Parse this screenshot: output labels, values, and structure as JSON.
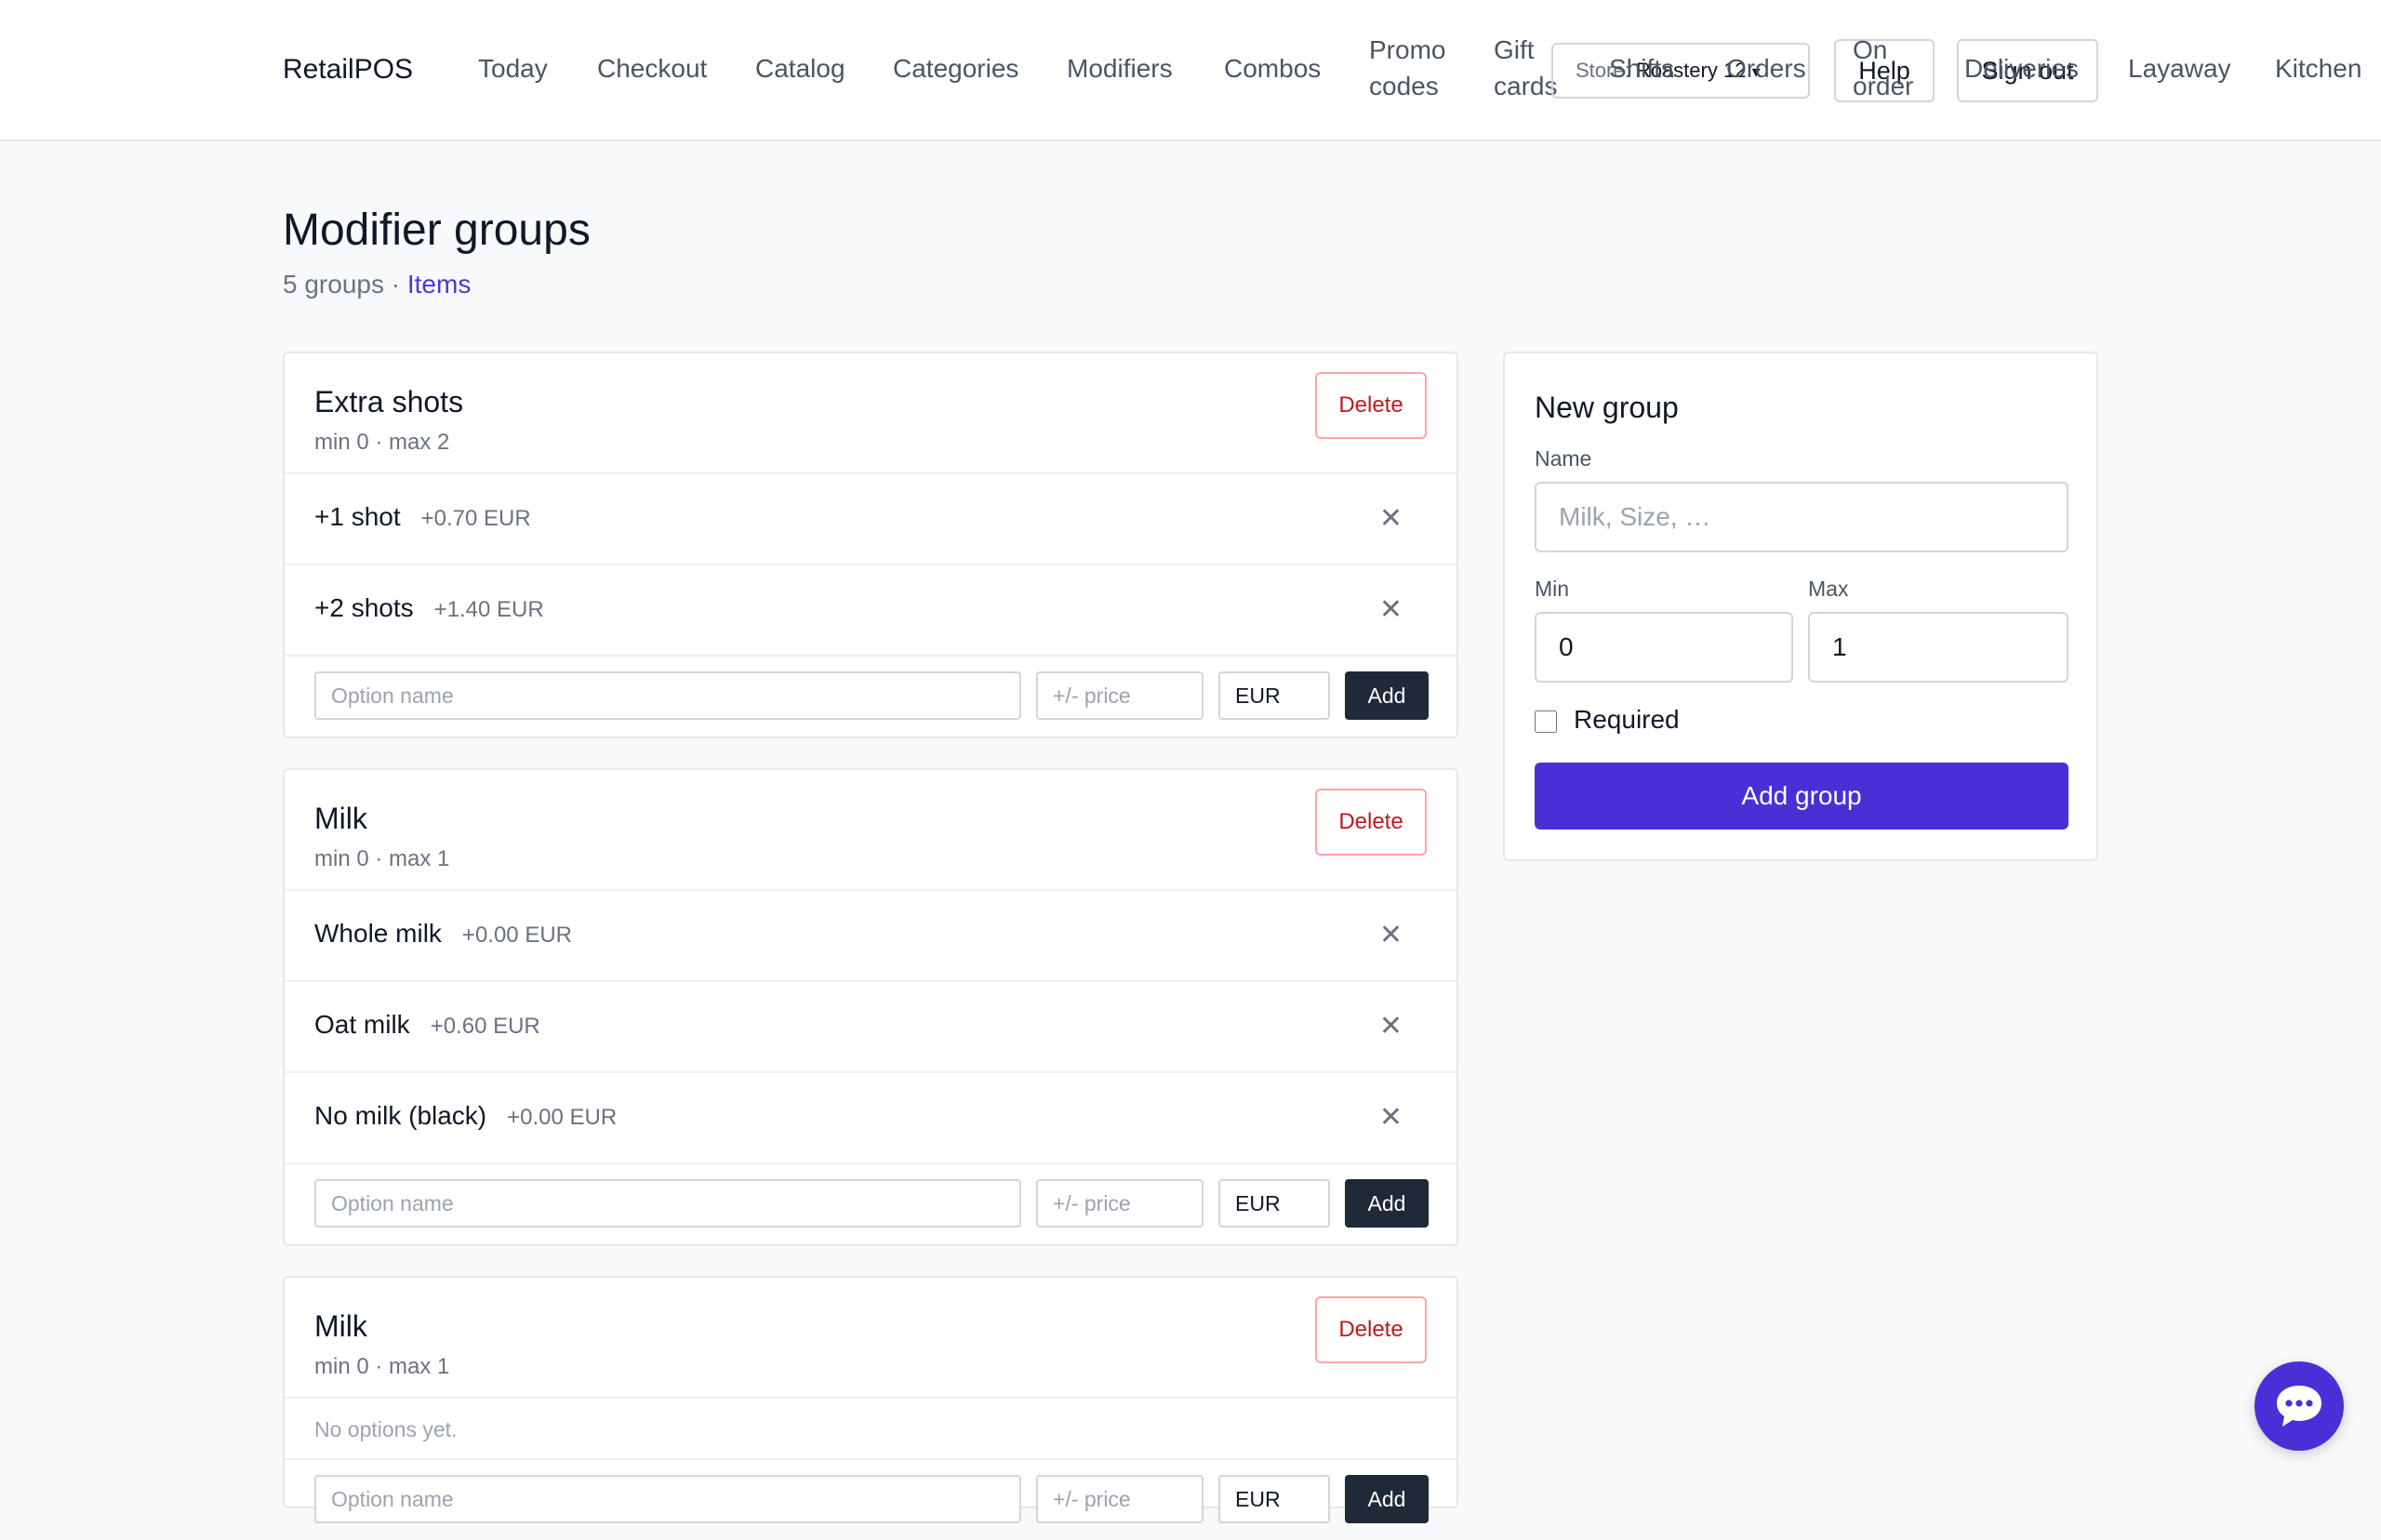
{
  "app": {
    "brand": "RetailPOS"
  },
  "nav": {
    "items": [
      "Today",
      "Checkout",
      "Catalog",
      "Categories",
      "Modifiers",
      "Combos",
      "Promo codes",
      "Gift cards",
      "Shifts",
      "Orders",
      "On order",
      "Deliveries",
      "Layaway",
      "Kitchen"
    ]
  },
  "header": {
    "store_label": "Store:",
    "store_value": "Roastery 12",
    "help": "Help",
    "sign_out": "Sign out"
  },
  "page": {
    "title": "Modifier groups",
    "count": "5 groups",
    "separator": "·",
    "items_link": "Items"
  },
  "groups": [
    {
      "name": "Extra shots",
      "meta": "min 0 · max 2",
      "delete": "Delete",
      "options": [
        {
          "name": "+1 shot",
          "price": "+0.70 EUR"
        },
        {
          "name": "+2 shots",
          "price": "+1.40 EUR"
        }
      ],
      "form": {
        "name_placeholder": "Option name",
        "price_placeholder": "+/- price",
        "currency": "EUR",
        "add": "Add"
      }
    },
    {
      "name": "Milk",
      "meta": "min 0 · max 1",
      "delete": "Delete",
      "options": [
        {
          "name": "Whole milk",
          "price": "+0.00 EUR"
        },
        {
          "name": "Oat milk",
          "price": "+0.60 EUR"
        },
        {
          "name": "No milk (black)",
          "price": "+0.00 EUR"
        }
      ],
      "form": {
        "name_placeholder": "Option name",
        "price_placeholder": "+/- price",
        "currency": "EUR",
        "add": "Add"
      }
    },
    {
      "name": "Milk",
      "meta": "min 0 · max 1",
      "delete": "Delete",
      "empty": "No options yet.",
      "form": {
        "name_placeholder": "Option name",
        "price_placeholder": "+/- price",
        "currency": "EUR",
        "add": "Add"
      }
    }
  ],
  "new_group": {
    "title": "New group",
    "name_label": "Name",
    "name_placeholder": "Milk, Size, …",
    "min_label": "Min",
    "min_value": "0",
    "max_label": "Max",
    "max_value": "1",
    "required_label": "Required",
    "submit": "Add group"
  },
  "icons": {
    "remove": "close-icon",
    "chat": "chat-bubble-icon",
    "store_dropdown": "chevron-down-icon"
  },
  "colors": {
    "accent": "#4a2fd6",
    "danger": "#b91c1c",
    "dark_button": "#1f2937"
  }
}
